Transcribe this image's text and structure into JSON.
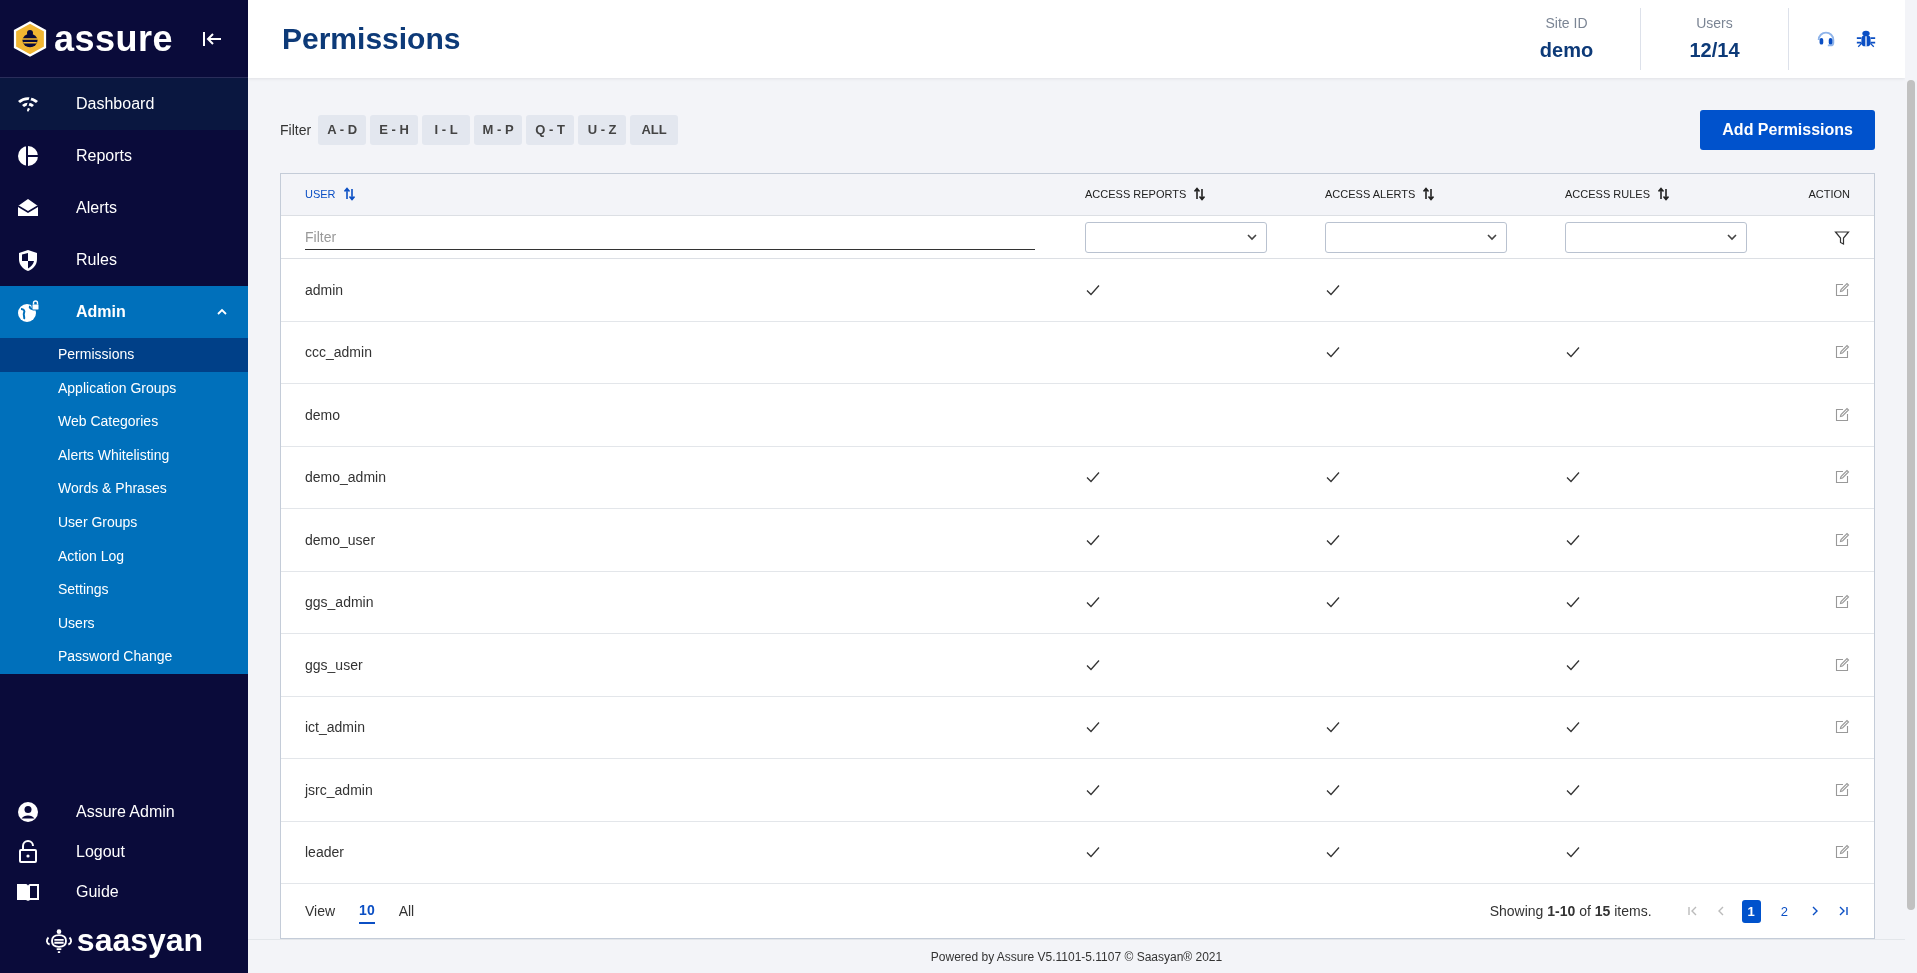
{
  "sidebar": {
    "logo": "assure",
    "nav": [
      {
        "label": "Dashboard",
        "selected": true,
        "expanded": false
      },
      {
        "label": "Reports",
        "selected": false,
        "expanded": false
      },
      {
        "label": "Alerts",
        "selected": false,
        "expanded": false
      },
      {
        "label": "Rules",
        "selected": false,
        "expanded": false
      },
      {
        "label": "Admin",
        "selected": false,
        "expanded": true,
        "children": [
          {
            "label": "Permissions",
            "selected": true
          },
          {
            "label": "Application Groups",
            "selected": false
          },
          {
            "label": "Web Categories",
            "selected": false
          },
          {
            "label": "Alerts Whitelisting",
            "selected": false
          },
          {
            "label": "Words & Phrases",
            "selected": false
          },
          {
            "label": "User Groups",
            "selected": false
          },
          {
            "label": "Action Log",
            "selected": false
          },
          {
            "label": "Settings",
            "selected": false
          },
          {
            "label": "Users",
            "selected": false
          },
          {
            "label": "Password Change",
            "selected": false
          }
        ]
      }
    ],
    "bottom": [
      {
        "label": "Assure Admin"
      },
      {
        "label": "Logout"
      },
      {
        "label": "Guide"
      }
    ],
    "brand": "saasyan"
  },
  "header": {
    "title": "Permissions",
    "stats": [
      {
        "label": "Site ID",
        "value": "demo"
      },
      {
        "label": "Users",
        "value": "12/14"
      }
    ]
  },
  "filter": {
    "label": "Filter",
    "buttons": [
      "A - D",
      "E - H",
      "I - L",
      "M - P",
      "Q - T",
      "U - Z",
      "ALL"
    ]
  },
  "add_button": "Add Permissions",
  "table": {
    "columns": [
      {
        "label": "USER",
        "kind": "sortable",
        "active": true
      },
      {
        "label": "ACCESS REPORTS",
        "kind": "sortable",
        "active": false
      },
      {
        "label": "ACCESS ALERTS",
        "kind": "sortable",
        "active": false
      },
      {
        "label": "ACCESS RULES",
        "kind": "sortable",
        "active": false
      },
      {
        "label": "ACTION",
        "kind": "plain",
        "active": false
      }
    ],
    "filter_placeholder": "Filter",
    "rows": [
      {
        "user": "admin",
        "reports": true,
        "alerts": true,
        "rules": false
      },
      {
        "user": "ccc_admin",
        "reports": false,
        "alerts": true,
        "rules": true
      },
      {
        "user": "demo",
        "reports": false,
        "alerts": false,
        "rules": false
      },
      {
        "user": "demo_admin",
        "reports": true,
        "alerts": true,
        "rules": true
      },
      {
        "user": "demo_user",
        "reports": true,
        "alerts": true,
        "rules": true
      },
      {
        "user": "ggs_admin",
        "reports": true,
        "alerts": true,
        "rules": true
      },
      {
        "user": "ggs_user",
        "reports": true,
        "alerts": false,
        "rules": true
      },
      {
        "user": "ict_admin",
        "reports": true,
        "alerts": true,
        "rules": true
      },
      {
        "user": "jsrc_admin",
        "reports": true,
        "alerts": true,
        "rules": true
      },
      {
        "user": "leader",
        "reports": true,
        "alerts": true,
        "rules": true
      }
    ]
  },
  "footer": {
    "view_label": "View",
    "view_options": [
      {
        "label": "10",
        "selected": true
      },
      {
        "label": "All",
        "selected": false
      }
    ],
    "summary": "Showing **1-10** of **15** items.",
    "pages": [
      {
        "label": "1",
        "selected": true
      },
      {
        "label": "2",
        "selected": false
      }
    ]
  },
  "powered_by": "Powered by Assure V5.1101-5.1107 © Saasyan® 2021"
}
